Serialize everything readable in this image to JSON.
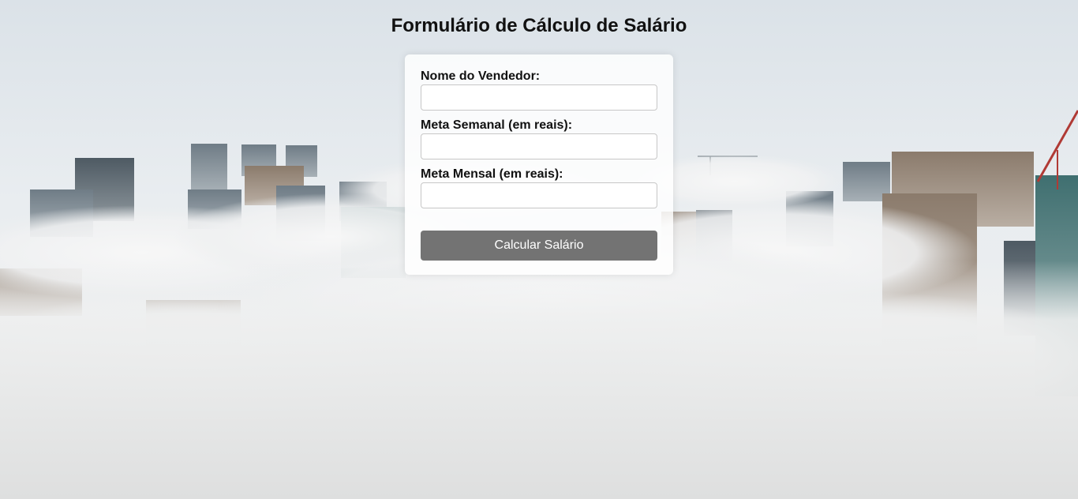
{
  "page": {
    "title": "Formulário de Cálculo de Salário"
  },
  "form": {
    "fields": [
      {
        "label": "Nome do Vendedor:",
        "value": "",
        "placeholder": ""
      },
      {
        "label": "Meta Semanal (em reais):",
        "value": "",
        "placeholder": ""
      },
      {
        "label": "Meta Mensal (em reais):",
        "value": "",
        "placeholder": ""
      }
    ],
    "submit_label": "Calcular Salário"
  },
  "background": {
    "description_icon": "city-skyline-in-fog-photo",
    "sky_color": "#dfe5ea",
    "fog_color": "#f2f3f4",
    "building_color": "#7d8790"
  }
}
